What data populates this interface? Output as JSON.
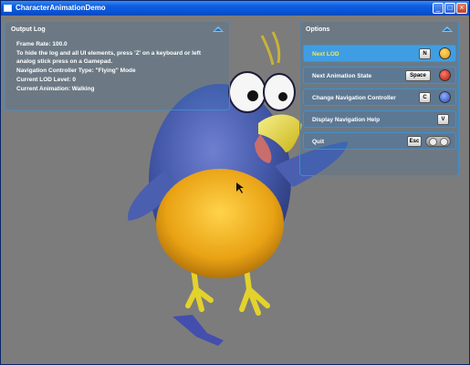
{
  "window": {
    "title": "CharacterAnimationDemo",
    "controls": {
      "minimize": "_",
      "maximize": "□",
      "close": "×"
    }
  },
  "output_log": {
    "title": "Output Log",
    "lines": [
      "Frame Rate: 100.0",
      "To hide the log and all UI elements, press 'Z' on a keyboard or left analog stick press on a Gamepad.",
      "Navigation Controller Type: \"Flying\" Mode",
      "Current LOD Level: 0",
      "Current Animation: Walking"
    ]
  },
  "options": {
    "title": "Options",
    "items": [
      {
        "label": "Next LOD",
        "key": "N",
        "pad": "y-icon",
        "active": true
      },
      {
        "label": "Next Animation State",
        "key": "Space",
        "pad": "b-icon"
      },
      {
        "label": "Change Navigation Controller",
        "key": "C",
        "pad": "x-icon"
      },
      {
        "label": "Display Navigation Help",
        "key": "V"
      },
      {
        "label": "Quit",
        "key": "Esc",
        "pad": "back-start-icon"
      }
    ]
  },
  "colors": {
    "panel_border": "#3a8ecf",
    "active_row": "#3f9ee3",
    "active_text": "#ffe640",
    "bird_body": "#4a5fb0",
    "bird_belly": "#f2b51c",
    "background": "#7c7c7c"
  }
}
